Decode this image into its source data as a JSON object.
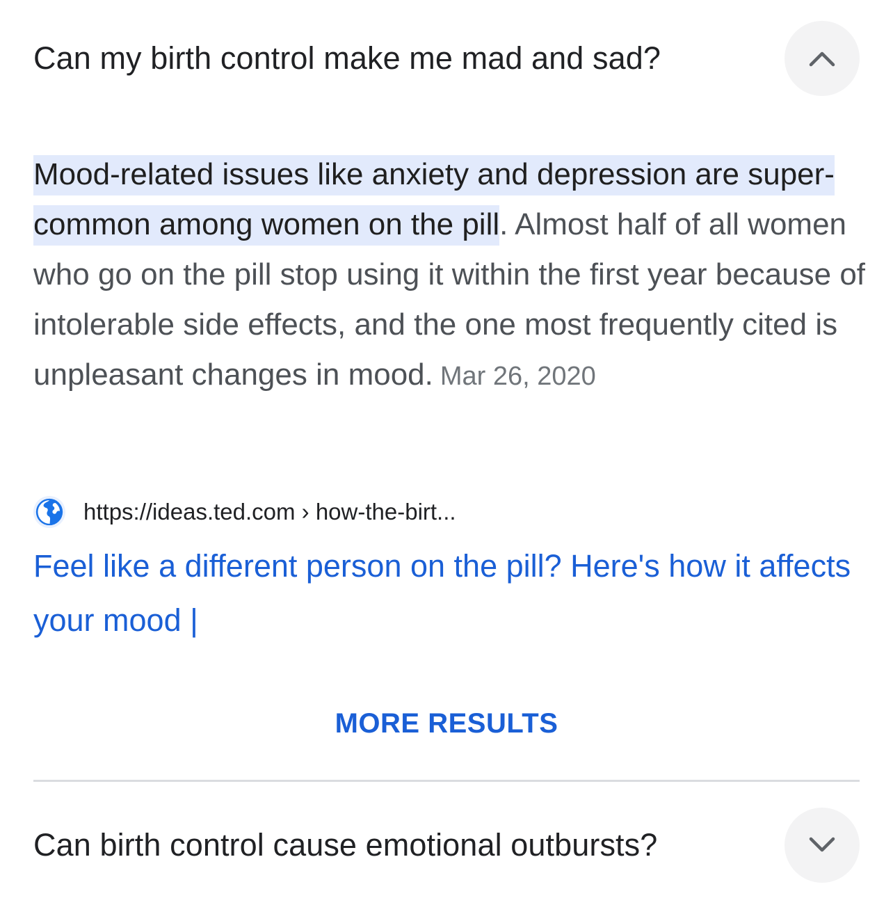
{
  "faq": [
    {
      "question": "Can my birth control make me mad and sad?",
      "expanded": true,
      "toggle_icon": "chevron-up-icon"
    },
    {
      "question": "Can birth control cause emotional outbursts?",
      "expanded": false,
      "toggle_icon": "chevron-down-icon"
    }
  ],
  "answer": {
    "highlight": "Mood-related issues like anxiety and depression are super-common among women on the pill",
    "body": ". Almost half of all women who go on the pill stop using it within the first year because of intolerable side effects, and the one most frequently cited is unpleasant changes in mood.",
    "date": "Mar 26, 2020"
  },
  "source": {
    "icon": "globe-icon",
    "url": "https://ideas.ted.com › how-the-birt..."
  },
  "result": {
    "title": "Feel like a different person on the pill? Here's how it affects your mood |"
  },
  "more_results_label": "MORE RESULTS",
  "colors": {
    "link": "#1a5fd6",
    "highlight": "#e2eafc",
    "text": "#202124",
    "muted": "#4d5156"
  }
}
